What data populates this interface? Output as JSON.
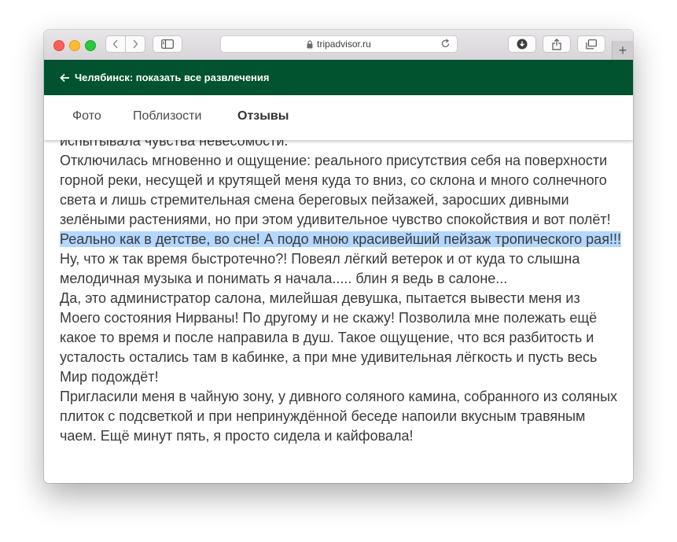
{
  "browser": {
    "address": "tripadvisor.ru"
  },
  "header": {
    "back_label": "Челябинск: показать все развлечения"
  },
  "tabs": [
    {
      "label": "Фото",
      "active": false
    },
    {
      "label": "Поблизости",
      "active": false
    },
    {
      "label": "Отзывы",
      "active": true
    }
  ],
  "review": {
    "top_partial": "испытывала чувства невесомости.",
    "p1_before": "Отключилась мгновенно и ощущение: реального присутствия себя на поверхности горной реки, несущей и крутящей меня куда то вниз, со склона и много солнечного света и лишь стремительная смена береговых пейзажей, заросших дивными зелёными растениями, но при этом удивительное чувство спокойствия и вот полёт! ",
    "p1_highlight": "Реально как в детстве, во сне! А подо мною красивейший пейзаж тропического рая!!!",
    "p2": "Ну, что ж так время быстротечно?! Повеял лёгкий ветерок и от куда то слышна мелодичная музыка и понимать я начала..... блин я ведь в салоне...",
    "p3": "Да, это администратор салона, милейшая девушка, пытается вывести меня из Моего состояния Нирваны! По другому и не скажу! Позволила мне полежать ещё какое то время и после направила в душ. Такое ощущение, что вся разбитость и усталость остались там в кабинке, а при мне удивительная лёгкость и пусть весь Мир подождёт!",
    "p4": "Пригласили меня в чайную зону, у дивного соляного камина, собранного из соляных плиток с подсветкой и при непринуждённой беседе напоили вкусным травяным чаем. Ещё минут пять, я просто сидела и кайфовала!"
  },
  "colors": {
    "header_green": "#00532e",
    "selection": "#b3d7fe"
  }
}
